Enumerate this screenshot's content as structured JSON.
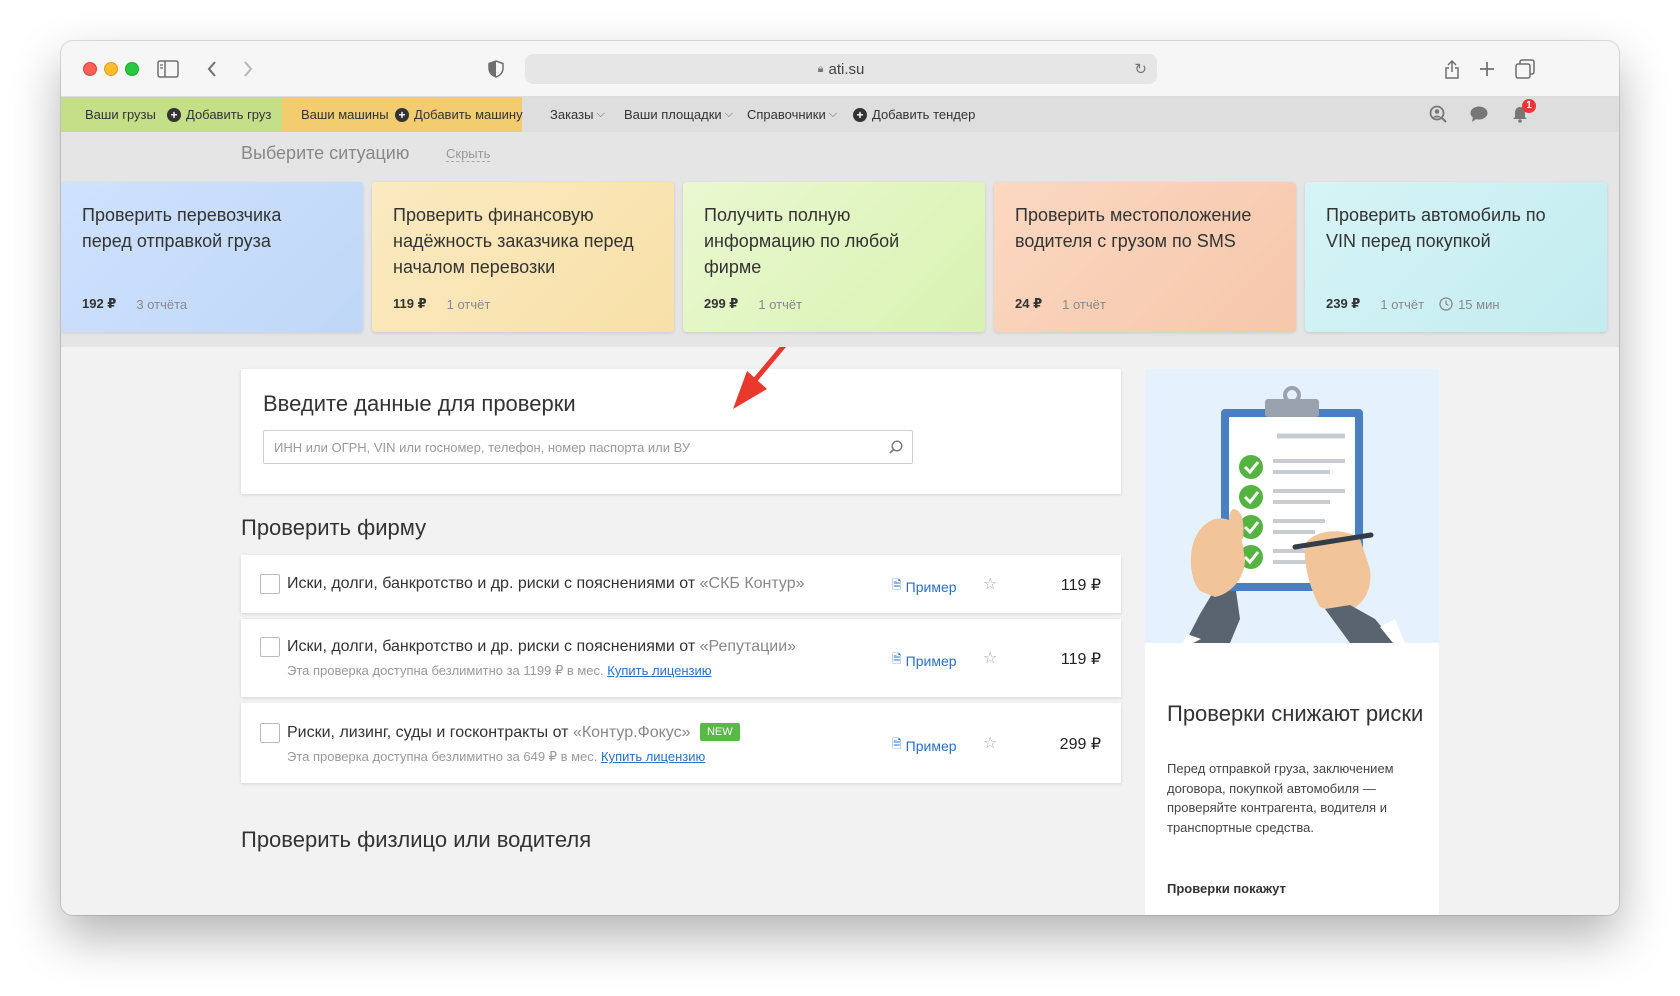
{
  "browser": {
    "url": "ati.su"
  },
  "nav": {
    "your_cargo": "Ваши грузы",
    "add_cargo": "Добавить груз",
    "your_trucks": "Ваши машины",
    "add_truck": "Добавить машину",
    "orders": "Заказы",
    "platforms": "Ваши площадки",
    "references": "Справочники",
    "add_tender": "Добавить тендер",
    "notification_count": "1"
  },
  "situation": {
    "title": "Выберите ситуацию",
    "hide": "Скрыть",
    "cards": [
      {
        "title": "Проверить перевозчика перед отправкой груза",
        "price": "192 ₽",
        "reports": "3 отчёта",
        "color": "#c9ddfb"
      },
      {
        "title": "Проверить финансовую надёжность заказчика перед началом перевозки",
        "price": "119 ₽",
        "reports": "1 отчёт",
        "color": "#f9e5b4"
      },
      {
        "title": "Получить полную информацию по любой фирме",
        "price": "299 ₽",
        "reports": "1 отчёт",
        "color": "#e2f5c2"
      },
      {
        "title": "Проверить местоположение водителя с грузом по SMS",
        "price": "24 ₽",
        "reports": "1 отчёт",
        "color": "#f8d0b6"
      },
      {
        "title": "Проверить автомобиль по VIN перед покупкой",
        "price": "239 ₽",
        "reports": "1 отчёт",
        "time": "15 мин",
        "color": "#cdf0f3"
      }
    ]
  },
  "search": {
    "title": "Введите данные для проверки",
    "placeholder": "ИНН или ОГРН, VIN или госномер, телефон, номер паспорта или ВУ"
  },
  "firm": {
    "title": "Проверить фирму",
    "rows": [
      {
        "title": "Иски, долги, банкротство и др. риски с пояснениями от",
        "source": "«СКБ Контур»",
        "example": "Пример",
        "price": "119 ₽"
      },
      {
        "title": "Иски, долги, банкротство и др. риски с пояснениями от",
        "source": "«Репутации»",
        "sub": "Эта проверка доступна безлимитно за 1199 ₽ в мес.",
        "sub_link": "Купить лицензию",
        "example": "Пример",
        "price": "119 ₽"
      },
      {
        "title": "Риски, лизинг, суды и госконтракты от",
        "source": "«Контур.Фокус»",
        "badge": "NEW",
        "sub": "Эта проверка доступна безлимитно за 649 ₽ в мес.",
        "sub_link": "Купить лицензию",
        "example": "Пример",
        "price": "299 ₽"
      }
    ]
  },
  "person": {
    "title": "Проверить физлицо или водителя"
  },
  "sidebar": {
    "title": "Проверки снижают риски",
    "text": "Перед отправкой груза, заключением договора, покупкой автомобиля — проверяйте контрагента, водителя и транспортные средства.",
    "bold": "Проверки покажут"
  },
  "colors": {
    "accent_link": "#2a6fc9",
    "badge_green": "#58b947",
    "arrow_red": "#e8392c"
  }
}
